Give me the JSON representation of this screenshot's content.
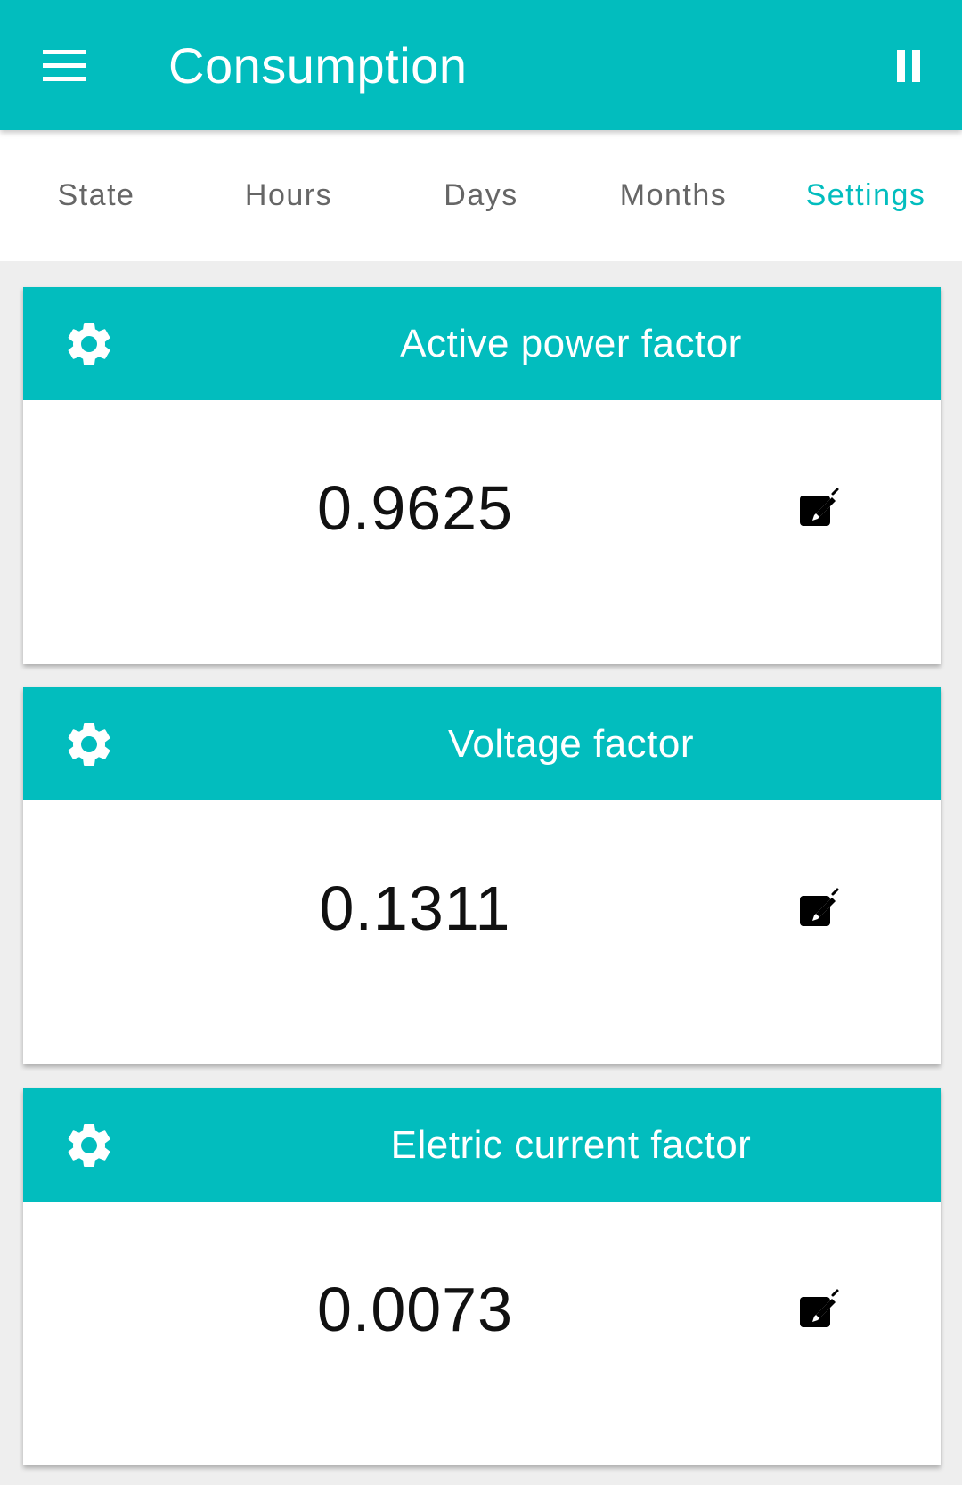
{
  "appbar": {
    "title": "Consumption",
    "menu_icon": "menu-icon",
    "pause_icon": "pause-icon"
  },
  "tabs": [
    {
      "label": "State",
      "active": false
    },
    {
      "label": "Hours",
      "active": false
    },
    {
      "label": "Days",
      "active": false
    },
    {
      "label": "Months",
      "active": false
    },
    {
      "label": "Settings",
      "active": true
    }
  ],
  "cards": [
    {
      "title": "Active power factor",
      "value": "0.9625",
      "icon": "gear-icon",
      "action_icon": "edit-icon"
    },
    {
      "title": "Voltage factor",
      "value": "0.1311",
      "icon": "gear-icon",
      "action_icon": "edit-icon"
    },
    {
      "title": "Eletric current factor",
      "value": "0.0073",
      "icon": "gear-icon",
      "action_icon": "edit-icon"
    }
  ],
  "colors": {
    "primary": "#02bdbe",
    "background": "#eeeeee",
    "tab_inactive": "#666666",
    "tab_active": "#02bdbe",
    "value_text": "#111111"
  }
}
